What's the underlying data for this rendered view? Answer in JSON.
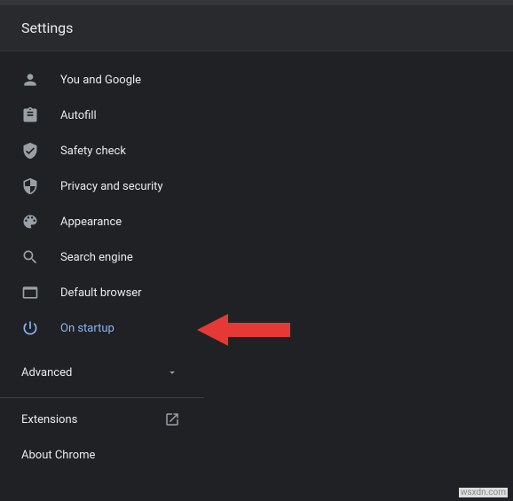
{
  "header": {
    "title": "Settings"
  },
  "nav": {
    "items": [
      {
        "id": "you-and-google",
        "label": "You and Google",
        "icon": "person-icon",
        "active": false
      },
      {
        "id": "autofill",
        "label": "Autofill",
        "icon": "clipboard-icon",
        "active": false
      },
      {
        "id": "safety-check",
        "label": "Safety check",
        "icon": "shield-check-icon",
        "active": false
      },
      {
        "id": "privacy-security",
        "label": "Privacy and security",
        "icon": "shield-icon",
        "active": false
      },
      {
        "id": "appearance",
        "label": "Appearance",
        "icon": "palette-icon",
        "active": false
      },
      {
        "id": "search-engine",
        "label": "Search engine",
        "icon": "search-icon",
        "active": false
      },
      {
        "id": "default-browser",
        "label": "Default browser",
        "icon": "browser-icon",
        "active": false
      },
      {
        "id": "on-startup",
        "label": "On startup",
        "icon": "power-icon",
        "active": true
      }
    ]
  },
  "advanced": {
    "label": "Advanced"
  },
  "bottom": {
    "extensions": {
      "label": "Extensions"
    },
    "about": {
      "label": "About Chrome"
    }
  },
  "annotation": {
    "arrow_color": "#e53935"
  },
  "watermark": "wsxdn.com"
}
